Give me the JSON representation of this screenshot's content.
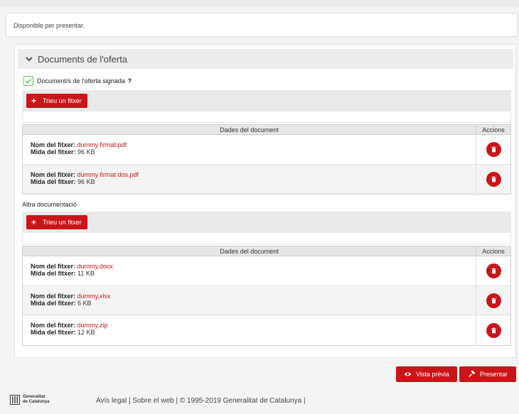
{
  "status": {
    "text": "Disponible per presentar."
  },
  "section": {
    "title": "Documents de l'oferta",
    "signed_label": "Document/s de l'oferta signada",
    "help_mark": "?"
  },
  "upload": {
    "button_label": "Trieu un fitxer"
  },
  "table": {
    "col_data": "Dades del document",
    "col_actions": "Accions",
    "name_label": "Nom del fitxer:",
    "size_label": "Mida del fitxer:"
  },
  "signed_docs": [
    {
      "name": "dummy firmat.pdf",
      "size": "96 KB"
    },
    {
      "name": "dummy firmat dos.pdf",
      "size": "96 KB"
    }
  ],
  "other": {
    "title": "Altra documentació"
  },
  "other_docs": [
    {
      "name": "dummy.docx",
      "size": "11 KB"
    },
    {
      "name": "dummy.xlsx",
      "size": "6 KB"
    },
    {
      "name": "dummy.zip",
      "size": "12 KB"
    }
  ],
  "actions": {
    "preview_label": "Vista prèvia",
    "submit_label": "Presentar"
  },
  "footer": {
    "logo_line1": "Generalitat",
    "logo_line2": "de Catalunya",
    "text": "Avís legal | Sobre el web | © 1995-2019 Generalitat de Catalunya |"
  },
  "icons": {
    "chevron": "chevron-down-icon",
    "check": "check-icon",
    "plus": "plus-icon",
    "trash": "trash-icon",
    "eye": "eye-icon",
    "gavel": "gavel-icon"
  },
  "colors": {
    "accent": "#c9151a",
    "check": "#5cb85c"
  }
}
